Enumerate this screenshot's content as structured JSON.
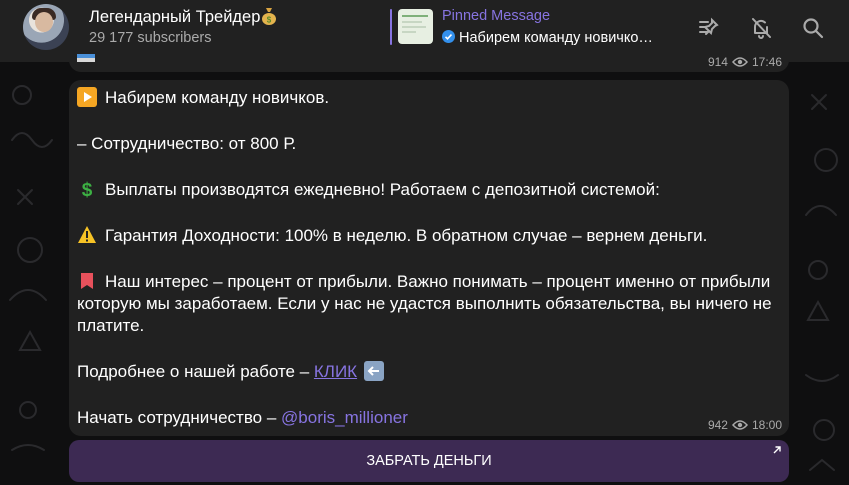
{
  "header": {
    "channel_title": "Легендарный Трейдер",
    "subscribers": "29 177 subscribers",
    "pinned": {
      "label": "Pinned Message",
      "text": "Набирем команду новичко…"
    },
    "icons": [
      "unpin-all-icon",
      "mute-icon",
      "search-icon"
    ]
  },
  "previous_message": {
    "views": "914",
    "time": "17:46"
  },
  "message": {
    "line1": "Набирем команду новичков.",
    "line2": "– Сотрудничество: от 800 Р.",
    "line3": "Выплаты производятся ежедневно! Работаем с депозитной системой:",
    "line4": "Гарантия Доходности: 100% в неделю. В обратном случае – вернем деньги.",
    "line5": "Наш интерес – процент от прибыли. Важно понимать – процент именно от прибыли которую мы заработаем. Если у нас не удастся выполнить обязательства, вы ничего не платите.",
    "line6_prefix": "Подробнее о нашей работе – ",
    "line6_link": "КЛИК",
    "line7_prefix": "Начать сотрудничество – ",
    "line7_mention": "@boris_millioner",
    "views": "942",
    "time": "18:00"
  },
  "inline_button": {
    "label": "ЗАБРАТЬ ДЕНЬГИ"
  },
  "colors": {
    "accent": "#8774e1",
    "bubble": "#212121",
    "button": "#3d2a53",
    "muted_text": "#aaaaaa"
  }
}
